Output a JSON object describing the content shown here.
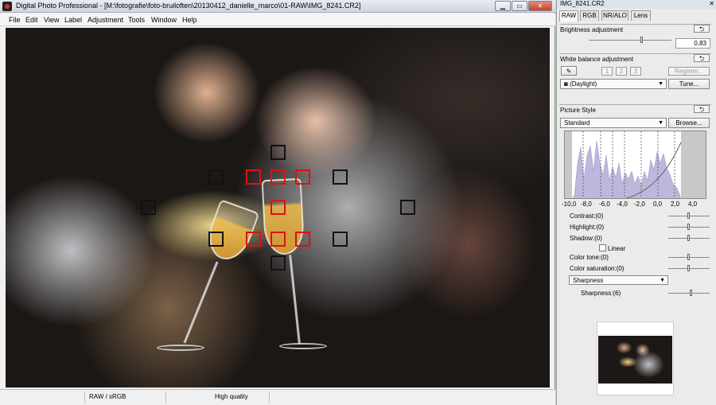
{
  "window": {
    "title": "Digital Photo Professional - [M:\\fotografie\\foto-bruiloften\\20130412_danielle_marco\\01-RAW\\IMG_8241.CR2]",
    "min_symbol": "▁",
    "max_symbol": "▭",
    "close_symbol": "✕"
  },
  "menu": [
    "File",
    "Edit",
    "View",
    "Label",
    "Adjustment",
    "Tools",
    "Window",
    "Help"
  ],
  "status": {
    "format": "RAW / sRGB",
    "quality": "High quality"
  },
  "palette": {
    "title": "IMG_8241.CR2",
    "close_symbol": "✕",
    "tabs": [
      "RAW",
      "RGB",
      "NR/ALO",
      "Lens"
    ],
    "active_tab": "RAW",
    "reset_symbol": "⮌",
    "brightness": {
      "label": "Brightness adjustment",
      "value": "0,83",
      "level_fraction": 0.55
    },
    "white_balance": {
      "label": "White balance adjustment",
      "presets": [
        "1",
        "2",
        "3"
      ],
      "register_label": "Register...",
      "preset_value": "(Daylight)",
      "tune_label": "Tune..."
    },
    "picture_style": {
      "label": "Picture Style",
      "style_value": "Standard",
      "browse_label": "Browse...",
      "axis_ticks": [
        "-10,0",
        "-8,0",
        "-6,0",
        "-4,0",
        "-2,0",
        "0,0",
        "2,0",
        "4,0"
      ],
      "adjustments": [
        {
          "label": "Contrast:(0)"
        },
        {
          "label": "Highlight:(0)"
        },
        {
          "label": "Shadow:(0)"
        }
      ],
      "linear_label": "Linear",
      "color_tone": "Color tone:(0)",
      "color_saturation": "Color saturation:(0)",
      "sharpness_mode": "Sharpness",
      "sharpness_value": "Sharpness:(6)"
    }
  },
  "colors": {
    "af_active": "#e01010",
    "af_inactive": "#111111",
    "histogram_fill": "#bcb8dc"
  }
}
